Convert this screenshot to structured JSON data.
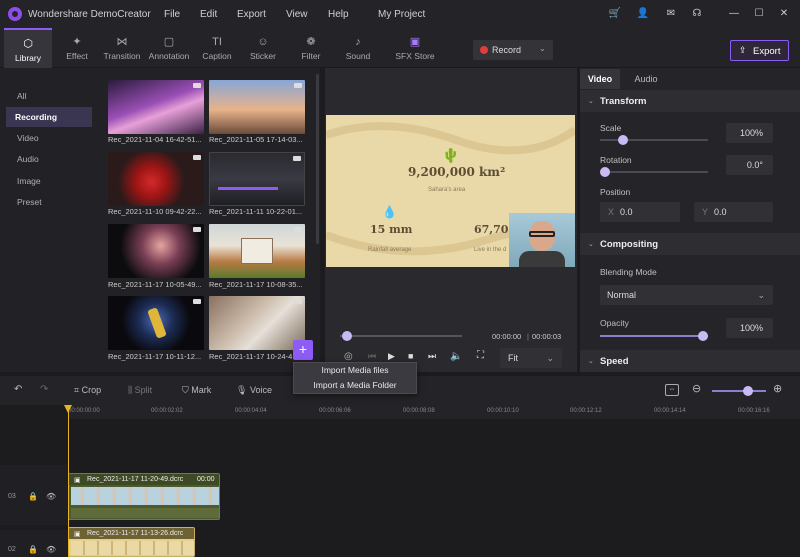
{
  "app": {
    "title": "Wondershare DemoCreator",
    "project": "My Project"
  },
  "menu": [
    "File",
    "Edit",
    "Export",
    "View",
    "Help"
  ],
  "toolbar": {
    "tools": [
      "Library",
      "Effect",
      "Transition",
      "Annotation",
      "Caption",
      "Sticker",
      "Filter",
      "Sound",
      "SFX Store"
    ],
    "record_label": "Record",
    "export_label": "Export"
  },
  "sidebar": {
    "items": [
      "All",
      "Recording",
      "Video",
      "Audio",
      "Image",
      "Preset"
    ],
    "active": "Recording"
  },
  "media": [
    {
      "label": "Rec_2021-11-04 16-42-51..."
    },
    {
      "label": "Rec_2021-11-05 17-14-03..."
    },
    {
      "label": "Rec_2021-11-10 09-42-22..."
    },
    {
      "label": "Rec_2021-11-11 10-22-01..."
    },
    {
      "label": "Rec_2021-11-17 10-05-49..."
    },
    {
      "label": "Rec_2021-11-17 10-08-35..."
    },
    {
      "label": "Rec_2021-11-17 10-11-12..."
    },
    {
      "label": "Rec_2021-11-17 10-24-4"
    }
  ],
  "preview": {
    "stat_big": "9,200,000 km²",
    "stat_big_caption": "Sahara's area",
    "stat2": "15 mm",
    "stat2_caption": "Rainfall average",
    "stat3": "67,700",
    "stat3_caption": "Live in the d",
    "time_current": "00:00:00",
    "time_total": "00:00:03",
    "fit_label": "Fit"
  },
  "props": {
    "tabs": [
      "Video",
      "Audio"
    ],
    "transform_title": "Transform",
    "scale_label": "Scale",
    "scale_value": "100%",
    "rotation_label": "Rotation",
    "rotation_value": "0.0°",
    "position_label": "Position",
    "pos_x_label": "X",
    "pos_x_value": "0.0",
    "pos_y_label": "Y",
    "pos_y_value": "0.0",
    "compositing_title": "Compositing",
    "blending_label": "Blending Mode",
    "blending_value": "Normal",
    "opacity_label": "Opacity",
    "opacity_value": "100%",
    "speed_title": "Speed"
  },
  "context_menu": [
    "Import Media files",
    "Import a Media Folder"
  ],
  "edit_toolbar": {
    "crop": "Crop",
    "split": "Split",
    "mark": "Mark",
    "voice": "Voice"
  },
  "ruler": [
    "00:00:00:00",
    "00:00:02:02",
    "00:00:04:04",
    "00:00:06:06",
    "00:00:08:08",
    "00:00:10:10",
    "00:00:12:12",
    "00:00:14:14",
    "00:00:16:16"
  ],
  "tracks": [
    {
      "num": "03",
      "clip": "Rec_2021-11-17 11-20-49.dcrc",
      "duration": "00:00"
    },
    {
      "num": "02",
      "clip": "Rec_2021-11-17 11-13-26.dcrc",
      "duration": ""
    }
  ],
  "colors": {
    "accent": "#8d5cf6",
    "playhead": "#e6b422",
    "record": "#e23b3b"
  }
}
